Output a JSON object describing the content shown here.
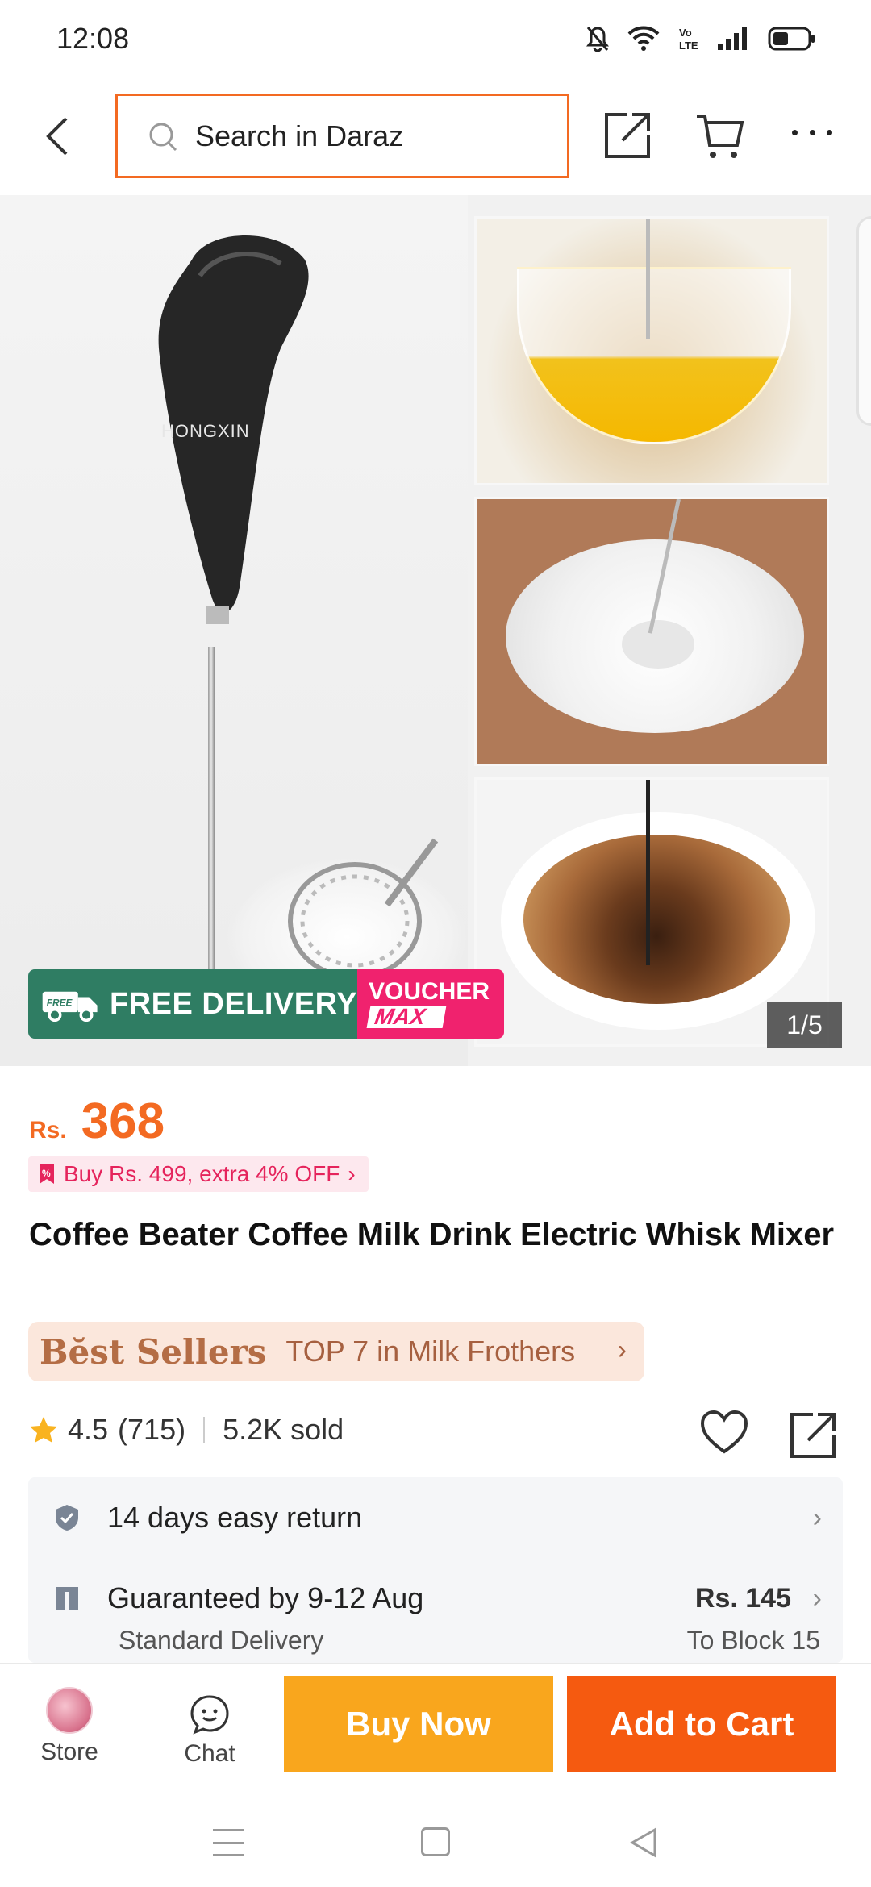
{
  "status_bar": {
    "time": "12:08",
    "icons": [
      "mute-icon",
      "wifi-icon",
      "volte-icon",
      "signal-icon",
      "battery-icon"
    ]
  },
  "topnav": {
    "search_placeholder": "Search in Daraz",
    "icons": [
      "back-icon",
      "search-icon",
      "share-icon",
      "cart-icon",
      "more-icon"
    ]
  },
  "hero": {
    "brand": "HONGXIN",
    "promo_free_badge": "FREE",
    "promo_free": "FREE DELIVERY",
    "promo_voucher": "VOUCHER",
    "promo_max": "MAX",
    "counter": "1/5"
  },
  "product": {
    "currency": "Rs.",
    "price": "368",
    "promo_tag": "Buy Rs. 499, extra 4% OFF",
    "title": "Coffee Beater Coffee Milk Drink Electric Whisk Mixer",
    "best_sellers_logo": "Bĕst Sellers",
    "best_sellers_rank": "TOP 7 in Milk Frothers",
    "rating": "4.5",
    "reviews": "(715)",
    "sold": "5.2K sold"
  },
  "info": {
    "return_label": "14 days easy return",
    "delivery_label": "Guaranteed by 9-12 Aug",
    "delivery_sub": "Standard Delivery",
    "delivery_price": "Rs. 145",
    "delivery_location": "To Block 15"
  },
  "action_bar": {
    "store_label": "Store",
    "chat_label": "Chat",
    "buy_now": "Buy Now",
    "add_to_cart": "Add to Cart"
  },
  "colors": {
    "accent": "#f36a22",
    "buy_now": "#f9a61d",
    "add_to_cart": "#f55a10",
    "free_delivery": "#2f7d63",
    "voucher": "#f0226e"
  }
}
